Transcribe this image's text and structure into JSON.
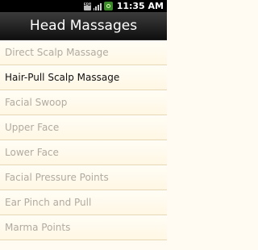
{
  "status_bar": {
    "sim_icon": "sim-3g-icon",
    "signal_icon": "signal-strength-icon",
    "battery_icon": "battery-charging-icon",
    "time": "11:35 AM"
  },
  "title_bar": {
    "title": "Head Massages"
  },
  "list": {
    "items": [
      {
        "label": "Direct Scalp Massage",
        "enabled": false
      },
      {
        "label": "Hair-Pull Scalp Massage",
        "enabled": true
      },
      {
        "label": "Facial Swoop",
        "enabled": false
      },
      {
        "label": "Upper Face",
        "enabled": false
      },
      {
        "label": "Lower Face",
        "enabled": false
      },
      {
        "label": "Facial Pressure Points",
        "enabled": false
      },
      {
        "label": "Ear Pinch and Pull",
        "enabled": false
      },
      {
        "label": "Marma Points",
        "enabled": false
      }
    ]
  },
  "colors": {
    "enabled_text": "#111111",
    "disabled_text": "#b0aaa0",
    "list_background": "#fffbf2",
    "title_bar_background": "#1e1e1e"
  }
}
